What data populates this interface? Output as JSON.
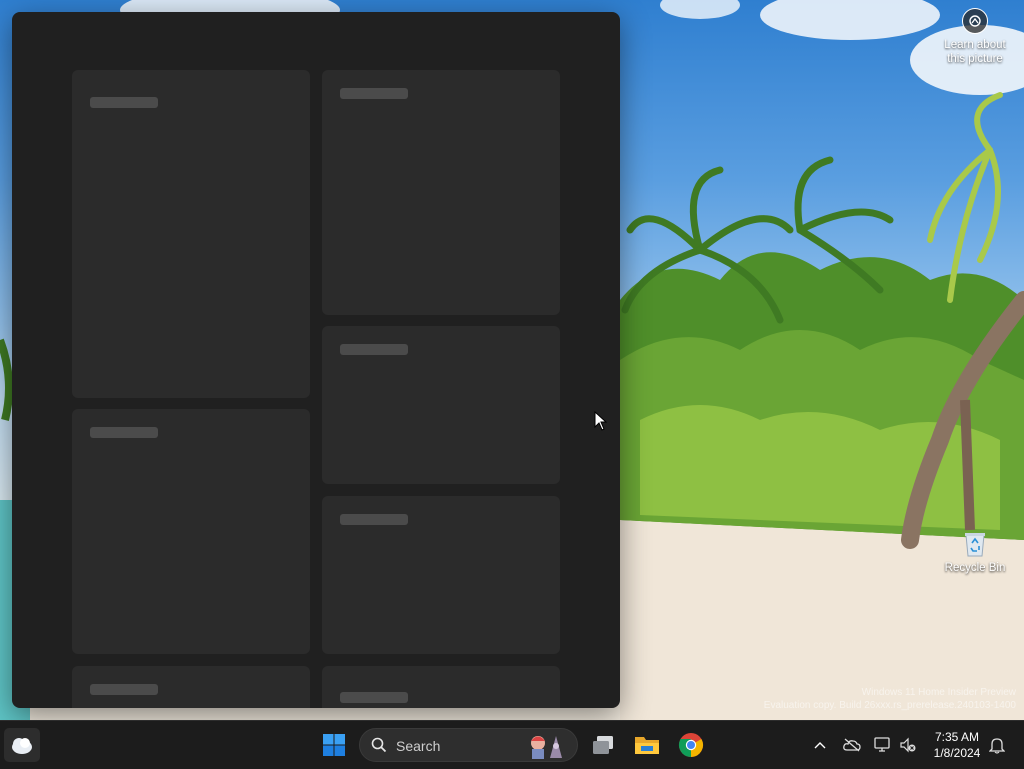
{
  "desktop": {
    "learn_about_picture": "Learn about\nthis picture",
    "recycle_bin_label": "Recycle Bin",
    "watermark_line1": "Windows 11 Home Insider Preview",
    "watermark_line2": "Evaluation copy. Build 26xxx.rs_prerelease.240103-1400"
  },
  "widgets_panel": {
    "state": "loading",
    "card_count": 8
  },
  "taskbar": {
    "search_label": "Search",
    "pinned": [
      "start-icon",
      "search",
      "task-view-icon",
      "file-explorer-icon",
      "chrome-icon"
    ],
    "tray_icons": [
      "chevron-up-icon",
      "onedrive-icon",
      "network-icon",
      "volume-muted-icon",
      "notification-bell-icon"
    ],
    "clock_time": "7:35 AM",
    "clock_date": "1/8/2024"
  },
  "colors": {
    "panel_bg": "#202020",
    "card_bg": "#2b2b2b",
    "placeholder": "#4b4b4b",
    "taskbar_bg": "#1c1c1c",
    "accent": "#0078d4"
  }
}
